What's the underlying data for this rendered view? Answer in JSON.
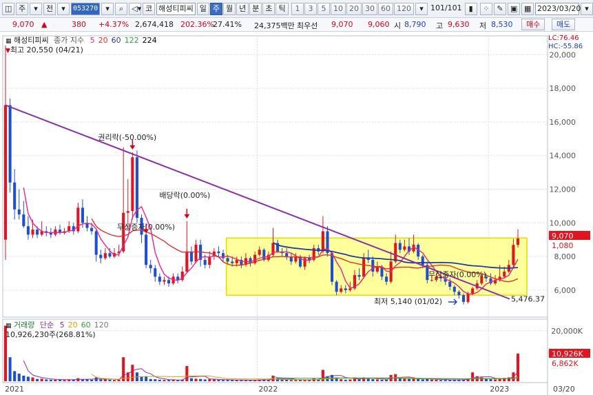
{
  "toolbar": {
    "menu_label": "주",
    "prev_label": "전",
    "stock_code": "053270",
    "code_label": "코",
    "stock_name": "해성티피씨",
    "periods": [
      {
        "label": "일",
        "selected": false
      },
      {
        "label": "주",
        "selected": true
      },
      {
        "label": "월",
        "selected": false
      },
      {
        "label": "년",
        "selected": false
      },
      {
        "label": "분",
        "selected": false
      },
      {
        "label": "초",
        "selected": false
      },
      {
        "label": "틱",
        "selected": false
      }
    ],
    "counts": [
      "1",
      "3",
      "5",
      "10",
      "20",
      "30",
      "60",
      "120"
    ],
    "page_counter": "101/101",
    "date": "2023/03/20"
  },
  "quote": {
    "price": "9,070",
    "change": "380",
    "change_pct": "+4.37%",
    "volume": "2,674,418",
    "volume_pct": "202.36%",
    "turnover": "27.41%",
    "amount": "24,375백만",
    "preferred": "최우선",
    "ask": "9,070",
    "bid": "9,060",
    "open_label": "시",
    "open": "8,790",
    "high_label": "고",
    "high": "9,630",
    "low_label": "저",
    "low": "8,530",
    "buy_label": "매수",
    "sell_label": "매도"
  },
  "price_legend": {
    "name": "해성티피씨",
    "series_label": "종가 지수",
    "ma_periods": [
      "5",
      "20",
      "60",
      "122",
      "224"
    ],
    "ma_colors": [
      "#ef1f8c",
      "#e0312a",
      "#1f3aa6",
      "#2ea043",
      "#000000"
    ],
    "high_note": "최고 20,550 (04/21)",
    "lc": "LC:76.46",
    "hc": "HC:-55.86"
  },
  "volume_legend": {
    "title": "거래량",
    "ma_label": "단순",
    "ma_periods": [
      "5",
      "20",
      "60",
      "120"
    ],
    "ma_colors": [
      "#8e2ab0",
      "#d4a400",
      "#2ea043",
      "#7a7a7a"
    ],
    "volume_note": "10,926,230주(268.81%)"
  },
  "annotations": {
    "rights": "권리락(-50.00%)",
    "dividend": "배당락(0.00%)",
    "capital_reduction": "무상증자(0.00%)",
    "later_event": "무상증자(0.00%)",
    "low_note": "최저 5,140 (01/02)",
    "trendline_end": "5,476.37"
  },
  "price_axis": {
    "ticks": [
      "20,000",
      "18,000",
      "16,000",
      "14,000",
      "12,000",
      "10,000",
      "8,000",
      "6,000"
    ],
    "current_label": "9,070",
    "sub_label": "1,080"
  },
  "volume_axis": {
    "ticks": [
      "20,000K"
    ],
    "current_label": "10,926K",
    "ma_label": "6,862K"
  },
  "x_axis": {
    "labels": [
      "2021",
      "2022",
      "2023"
    ],
    "end_label": "03/20"
  },
  "chart_data": {
    "type": "candlestick",
    "interval": "weekly",
    "ylim": [
      4600,
      21000
    ],
    "volume_ylim": [
      0,
      23500000
    ],
    "candles": [
      [
        9000,
        17000,
        20550,
        7800,
        22000000
      ],
      [
        17000,
        12400,
        17400,
        11800,
        9500000
      ],
      [
        12400,
        10800,
        13200,
        10200,
        4000000
      ],
      [
        10800,
        10500,
        12000,
        10200,
        3000000
      ],
      [
        10500,
        9800,
        11300,
        9700,
        2200000
      ],
      [
        9800,
        9300,
        10400,
        9000,
        1800000
      ],
      [
        9300,
        9600,
        10200,
        9100,
        1500000
      ],
      [
        9600,
        9300,
        9800,
        9100,
        900000
      ],
      [
        9300,
        9500,
        10100,
        9200,
        1000000
      ],
      [
        9500,
        9400,
        9800,
        9200,
        700000
      ],
      [
        9400,
        9300,
        9700,
        9100,
        600000
      ],
      [
        9300,
        9600,
        9800,
        9200,
        600000
      ],
      [
        9600,
        9400,
        9900,
        9300,
        600000
      ],
      [
        9400,
        9500,
        9700,
        9300,
        500000
      ],
      [
        9500,
        9800,
        10100,
        9400,
        700000
      ],
      [
        9800,
        9500,
        10000,
        9300,
        600000
      ],
      [
        9500,
        10900,
        11200,
        9400,
        1200000
      ],
      [
        10900,
        10000,
        11400,
        9700,
        800000
      ],
      [
        10000,
        9700,
        10400,
        9500,
        700000
      ],
      [
        9700,
        9500,
        10000,
        9300,
        600000
      ],
      [
        9500,
        8100,
        9600,
        7700,
        1500000
      ],
      [
        8100,
        7900,
        8400,
        7600,
        700000
      ],
      [
        7900,
        8200,
        8500,
        7800,
        800000
      ],
      [
        8200,
        8000,
        8500,
        7900,
        600000
      ],
      [
        8000,
        8200,
        8500,
        7900,
        500000
      ],
      [
        8200,
        8300,
        8700,
        8000,
        600000
      ],
      [
        8300,
        10600,
        14500,
        8200,
        9500000
      ],
      [
        10600,
        10700,
        12600,
        9600,
        3500000
      ],
      [
        10700,
        13900,
        14200,
        10200,
        6500000
      ],
      [
        13900,
        10300,
        14300,
        10000,
        3500000
      ],
      [
        10300,
        9300,
        10500,
        8800,
        1800000
      ],
      [
        9300,
        7500,
        9400,
        7300,
        2000000
      ],
      [
        7500,
        7300,
        7800,
        7000,
        900000
      ],
      [
        7300,
        6800,
        7500,
        6500,
        800000
      ],
      [
        6800,
        6500,
        7000,
        6300,
        600000
      ],
      [
        6500,
        6600,
        6800,
        6300,
        500000
      ],
      [
        6600,
        6400,
        6800,
        6200,
        500000
      ],
      [
        6400,
        6800,
        7000,
        6300,
        500000
      ],
      [
        6800,
        6600,
        7000,
        6400,
        400000
      ],
      [
        6600,
        7100,
        7400,
        6500,
        600000
      ],
      [
        7100,
        8300,
        10100,
        7000,
        6000000
      ],
      [
        8300,
        7700,
        8600,
        7500,
        1200000
      ],
      [
        7700,
        8700,
        9000,
        7600,
        1000000
      ],
      [
        8700,
        7800,
        9000,
        7400,
        900000
      ],
      [
        7800,
        7500,
        8100,
        7300,
        700000
      ],
      [
        7500,
        8000,
        8300,
        7300,
        800000
      ],
      [
        8000,
        8300,
        8500,
        7800,
        700000
      ],
      [
        8300,
        8200,
        8600,
        8000,
        600000
      ],
      [
        8200,
        7900,
        8400,
        7700,
        500000
      ],
      [
        7900,
        7700,
        8100,
        7500,
        500000
      ],
      [
        7700,
        7600,
        8000,
        7400,
        500000
      ],
      [
        7600,
        7800,
        8000,
        7400,
        400000
      ],
      [
        7800,
        7500,
        8000,
        7300,
        400000
      ],
      [
        7500,
        7900,
        8200,
        7400,
        400000
      ],
      [
        7900,
        7600,
        8000,
        7400,
        400000
      ],
      [
        7600,
        8100,
        8300,
        7500,
        500000
      ],
      [
        8100,
        8400,
        8600,
        8000,
        600000
      ],
      [
        8400,
        7800,
        8500,
        7700,
        700000
      ],
      [
        7800,
        8100,
        8300,
        7700,
        500000
      ],
      [
        8100,
        8800,
        9700,
        8000,
        2200000
      ],
      [
        8800,
        8300,
        9000,
        8200,
        1200000
      ],
      [
        8300,
        8200,
        8500,
        8000,
        700000
      ],
      [
        8200,
        8000,
        8500,
        7800,
        600000
      ],
      [
        8000,
        7700,
        8200,
        7500,
        500000
      ],
      [
        7700,
        8000,
        8200,
        7600,
        500000
      ],
      [
        8000,
        7400,
        8100,
        7300,
        600000
      ],
      [
        7400,
        7900,
        8000,
        7200,
        500000
      ],
      [
        7900,
        7800,
        8100,
        7600,
        500000
      ],
      [
        7800,
        8500,
        8700,
        7700,
        1100000
      ],
      [
        8500,
        8300,
        8700,
        8100,
        700000
      ],
      [
        8300,
        9500,
        10400,
        8200,
        4500000
      ],
      [
        9500,
        8200,
        9800,
        8000,
        2000000
      ],
      [
        8200,
        6500,
        8300,
        6300,
        2500000
      ],
      [
        6500,
        5900,
        6600,
        5700,
        1500000
      ],
      [
        5900,
        6100,
        6300,
        5800,
        800000
      ],
      [
        6100,
        6000,
        6300,
        5800,
        600000
      ],
      [
        6000,
        6100,
        6500,
        5900,
        700000
      ],
      [
        6100,
        6900,
        7200,
        6000,
        1500000
      ],
      [
        6900,
        6800,
        7300,
        6600,
        800000
      ],
      [
        6800,
        7900,
        8200,
        6700,
        1500000
      ],
      [
        7900,
        7800,
        8400,
        7600,
        1000000
      ],
      [
        7800,
        7100,
        8000,
        6800,
        800000
      ],
      [
        7100,
        7400,
        7700,
        7000,
        700000
      ],
      [
        7400,
        6800,
        7500,
        6600,
        600000
      ],
      [
        6800,
        6500,
        7000,
        6300,
        600000
      ],
      [
        6500,
        7700,
        8300,
        6400,
        2500000
      ],
      [
        7700,
        8800,
        9300,
        7600,
        2800000
      ],
      [
        8800,
        8400,
        9000,
        8200,
        1200000
      ],
      [
        8400,
        8600,
        9000,
        8300,
        1000000
      ],
      [
        8600,
        8300,
        9100,
        8100,
        900000
      ],
      [
        8300,
        8700,
        9300,
        8200,
        1100000
      ],
      [
        8700,
        8000,
        8800,
        7800,
        900000
      ],
      [
        8000,
        7500,
        8100,
        7300,
        700000
      ],
      [
        7500,
        6600,
        7700,
        6400,
        1200000
      ],
      [
        6600,
        6600,
        6900,
        6500,
        700000
      ],
      [
        6600,
        6800,
        7000,
        6500,
        600000
      ],
      [
        6800,
        6700,
        7000,
        6500,
        500000
      ],
      [
        6700,
        6500,
        6900,
        6300,
        500000
      ],
      [
        6500,
        6200,
        6700,
        6000,
        500000
      ],
      [
        6200,
        5900,
        6300,
        5700,
        600000
      ],
      [
        5900,
        5700,
        6000,
        5500,
        700000
      ],
      [
        5700,
        5300,
        5800,
        5140,
        600000
      ],
      [
        5300,
        5800,
        5900,
        5200,
        900000
      ],
      [
        5800,
        6100,
        6200,
        5700,
        3500000
      ],
      [
        6100,
        6400,
        6600,
        6000,
        2000000
      ],
      [
        6400,
        6800,
        7000,
        6300,
        1500000
      ],
      [
        6800,
        6700,
        7000,
        6500,
        900000
      ],
      [
        6700,
        6400,
        7000,
        6300,
        800000
      ],
      [
        6400,
        6600,
        6900,
        6300,
        700000
      ],
      [
        6600,
        6800,
        7500,
        6500,
        1200000
      ],
      [
        6800,
        7100,
        7400,
        6700,
        1300000
      ],
      [
        7100,
        7500,
        7800,
        7000,
        1500000
      ],
      [
        7500,
        8690,
        9050,
        7300,
        3500000
      ],
      [
        8690,
        9070,
        9630,
        8530,
        10926230
      ]
    ]
  }
}
